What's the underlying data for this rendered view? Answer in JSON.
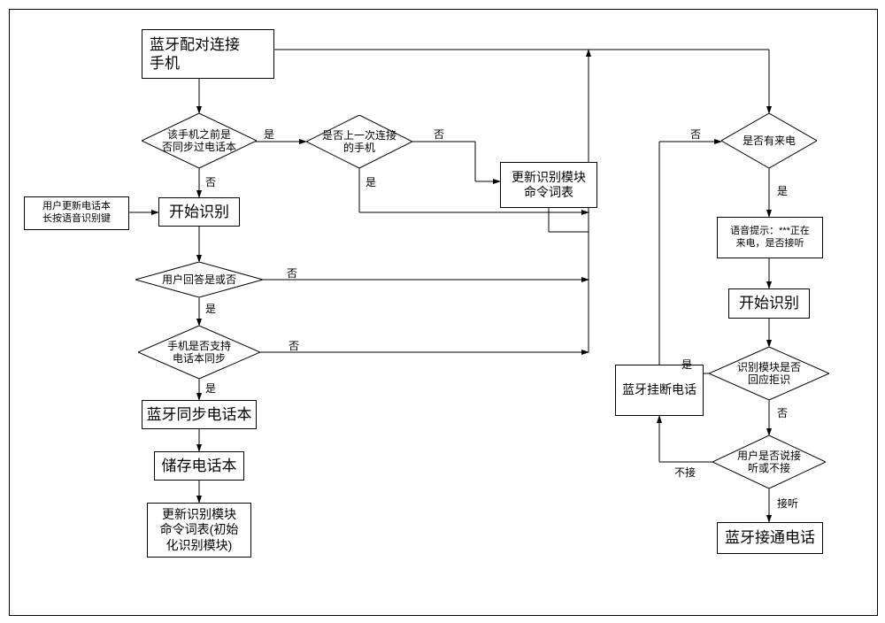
{
  "start": "蓝牙配对连接\n手机",
  "d_synced": "该手机之前是\n否同步过电话本",
  "d_last": "是否上一次连接\n的手机",
  "update_cmd": "更新识别模块\n命令词表",
  "start_recog_left": "开始识别",
  "ext_trigger": "用户更新电话本\n长按语音识别键",
  "d_user_ans": "用户回答是或否",
  "d_support": "手机是否支持\n电话本同步",
  "sync_pb": "蓝牙同步电话本",
  "store_pb": "储存电话本",
  "init_cmd": "更新识别模块\n命令词表(初始\n化识别模块)",
  "d_incoming": "是否有来电",
  "prompt": "语音提示：***正在\n来电，是否接听",
  "start_recog_right": "开始识别",
  "d_reject": "识别模块是否\n回应拒识",
  "d_accept": "用户是否说接\n听或不接",
  "hangup": "蓝牙挂断电话",
  "answer": "蓝牙接通电话",
  "labels": {
    "yes": "是",
    "no": "否",
    "accept": "接听",
    "reject": "不接"
  }
}
